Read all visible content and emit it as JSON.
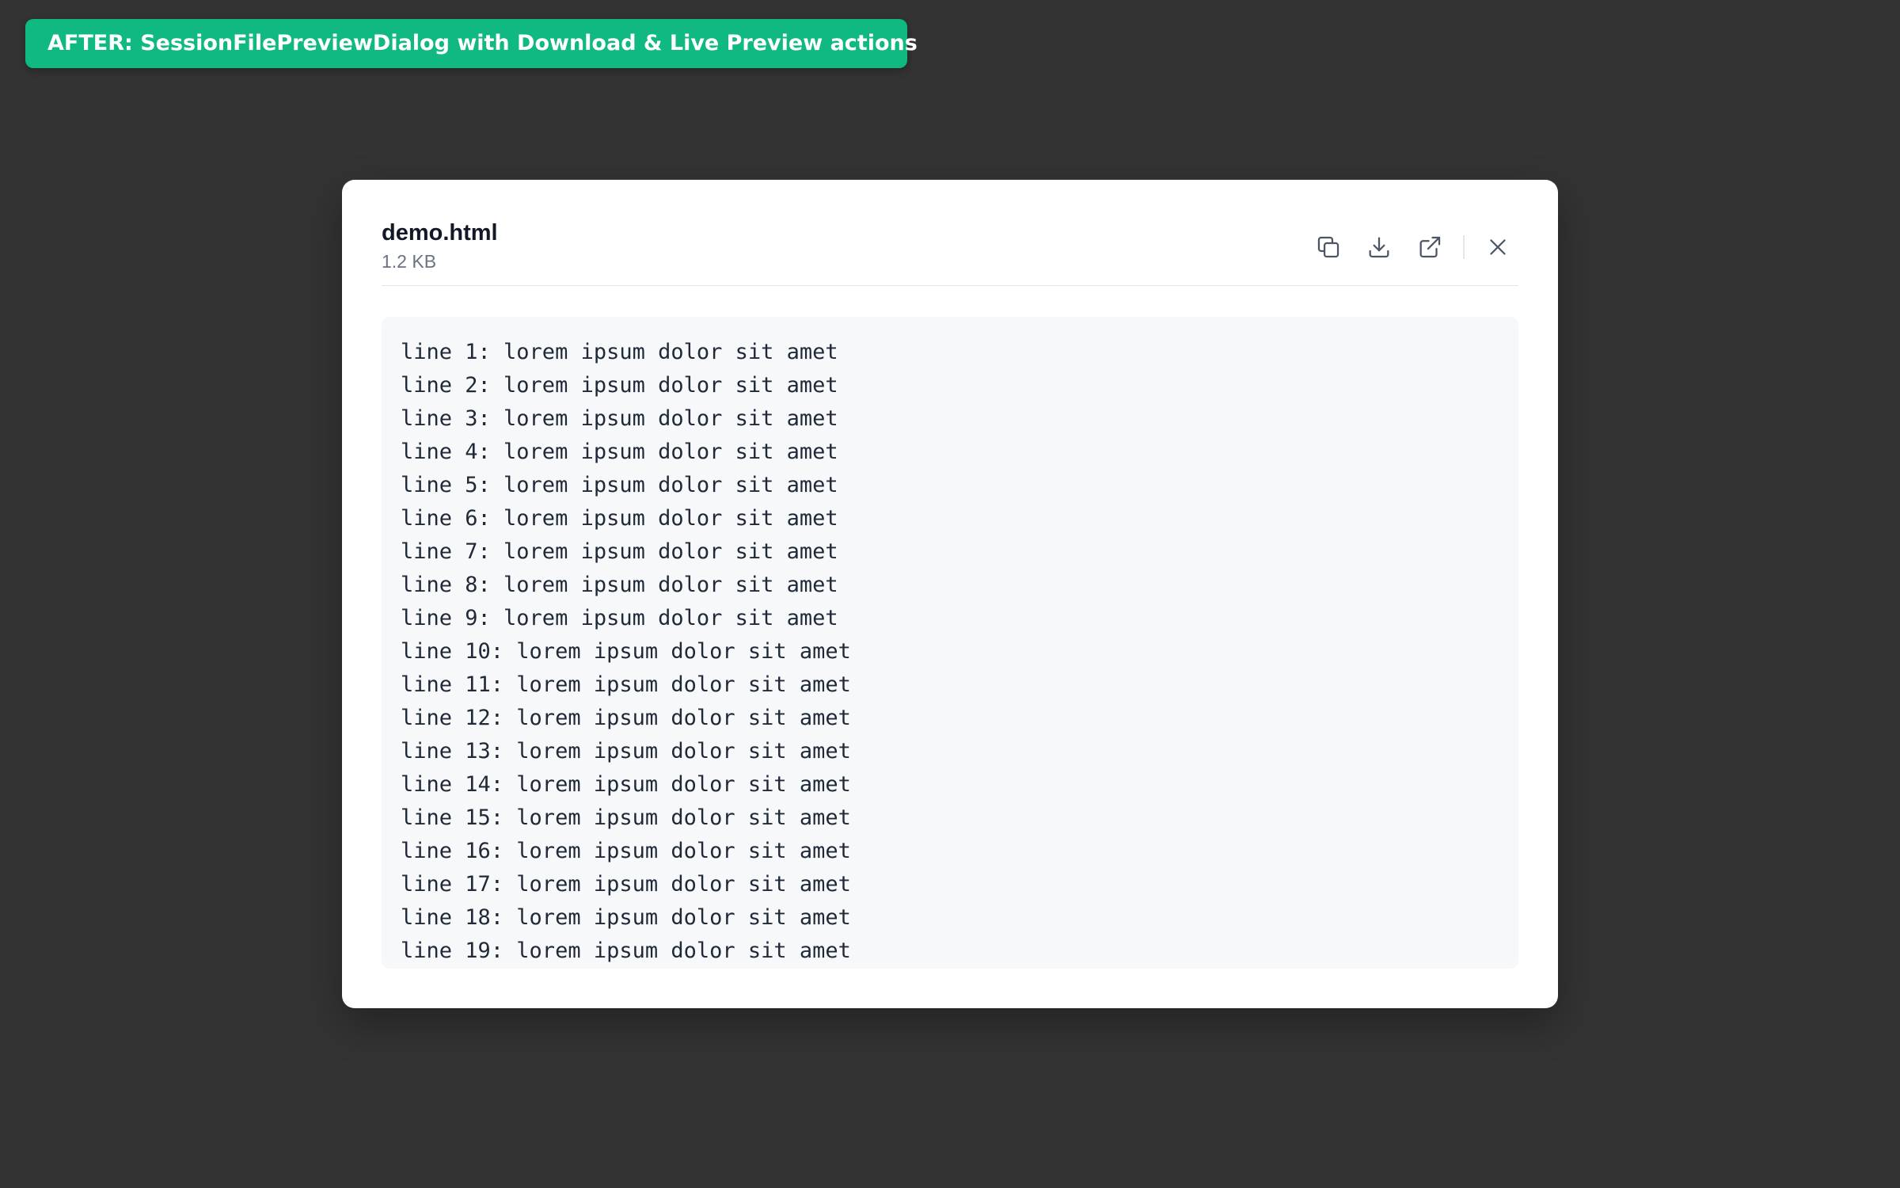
{
  "banner": {
    "text": "AFTER: SessionFilePreviewDialog with Download & Live Preview actions",
    "color": "#10b981"
  },
  "dialog": {
    "file_name": "demo.html",
    "file_size": "1.2 KB",
    "actions": [
      {
        "name": "copy-icon",
        "label": "Copy"
      },
      {
        "name": "download-icon",
        "label": "Download"
      },
      {
        "name": "external-link-icon",
        "label": "Live Preview"
      },
      {
        "name": "close-icon",
        "label": "Close"
      }
    ],
    "lines": [
      "line 1: lorem ipsum dolor sit amet",
      "line 2: lorem ipsum dolor sit amet",
      "line 3: lorem ipsum dolor sit amet",
      "line 4: lorem ipsum dolor sit amet",
      "line 5: lorem ipsum dolor sit amet",
      "line 6: lorem ipsum dolor sit amet",
      "line 7: lorem ipsum dolor sit amet",
      "line 8: lorem ipsum dolor sit amet",
      "line 9: lorem ipsum dolor sit amet",
      "line 10: lorem ipsum dolor sit amet",
      "line 11: lorem ipsum dolor sit amet",
      "line 12: lorem ipsum dolor sit amet",
      "line 13: lorem ipsum dolor sit amet",
      "line 14: lorem ipsum dolor sit amet",
      "line 15: lorem ipsum dolor sit amet",
      "line 16: lorem ipsum dolor sit amet",
      "line 17: lorem ipsum dolor sit amet",
      "line 18: lorem ipsum dolor sit amet",
      "line 19: lorem ipsum dolor sit amet"
    ]
  },
  "colors": {
    "background": "#333333",
    "dialog": "#ffffff",
    "code_background": "#f7f8fa",
    "icon": "#4b5563",
    "muted_text": "#6b7280"
  }
}
